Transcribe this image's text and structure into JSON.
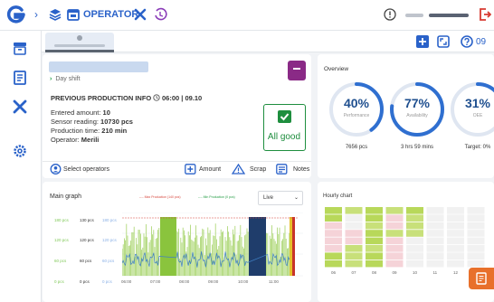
{
  "header": {
    "module_label": "OPERATOR",
    "colors": {
      "brand": "#2a62c9",
      "danger": "#d73a31"
    },
    "icons": [
      "logo-icon",
      "layers-icon",
      "calendar-icon",
      "tools-icon",
      "history-icon",
      "info-icon",
      "logout-icon"
    ]
  },
  "toolbar": {
    "help_label": "09",
    "icons": [
      "add-icon",
      "fullscreen-icon",
      "help-icon"
    ]
  },
  "sidebar": {
    "icons": [
      "archive-icon",
      "document-icon",
      "tools-icon",
      "settings-icon"
    ]
  },
  "production": {
    "shift_label": "Day shift",
    "previous_title": "PREVIOUS PRODUCTION INFO",
    "previous_time": "06:00 | 09.10",
    "entered_amount_label": "Entered amount:",
    "entered_amount_value": "10",
    "sensor_label": "Sensor reading:",
    "sensor_value": "10730 pcs",
    "production_time_label": "Production time:",
    "production_time_value": "210 min",
    "operator_label": "Operator:",
    "operator_value": "Merili",
    "status_label": "All good",
    "actions": {
      "select_operators": "Select operators",
      "amount": "Amount",
      "scrap": "Scrap",
      "notes": "Notes"
    }
  },
  "overview": {
    "title": "Overview",
    "metrics": [
      {
        "value": "40%",
        "label": "Performance",
        "sub": "7656 pcs",
        "fraction": 0.4
      },
      {
        "value": "77%",
        "label": "Availability",
        "sub": "3 hrs 59 mins",
        "fraction": 0.77
      },
      {
        "value": "31%",
        "label": "OEE",
        "sub": "Target: 0%",
        "fraction": 0.31
      }
    ]
  },
  "main_graph": {
    "title": "Main graph",
    "legend_max": "Max Production (140 pcs)",
    "legend_min": "Min Production (0 pcs)",
    "range_select": "Live",
    "y_labels": [
      {
        "left": "180 pcs",
        "mid": "130 pcs",
        "right": "180 pcs"
      },
      {
        "left": "120 pcs",
        "mid": "120 pcs",
        "right": "120 pcs"
      },
      {
        "left": "60 pcs",
        "mid": "60 pcs",
        "right": "60 pcs"
      },
      {
        "left": "0 pcs",
        "mid": "0 pcs",
        "right": "0 pcs"
      }
    ],
    "x_labels": [
      "06:00",
      "07:00",
      "08:00",
      "09:00",
      "10:00",
      "11:00"
    ]
  },
  "hourly_chart": {
    "title": "Hourly chart",
    "x_labels": [
      "06",
      "07",
      "08",
      "09",
      "10",
      "11",
      "12",
      "1"
    ]
  }
}
